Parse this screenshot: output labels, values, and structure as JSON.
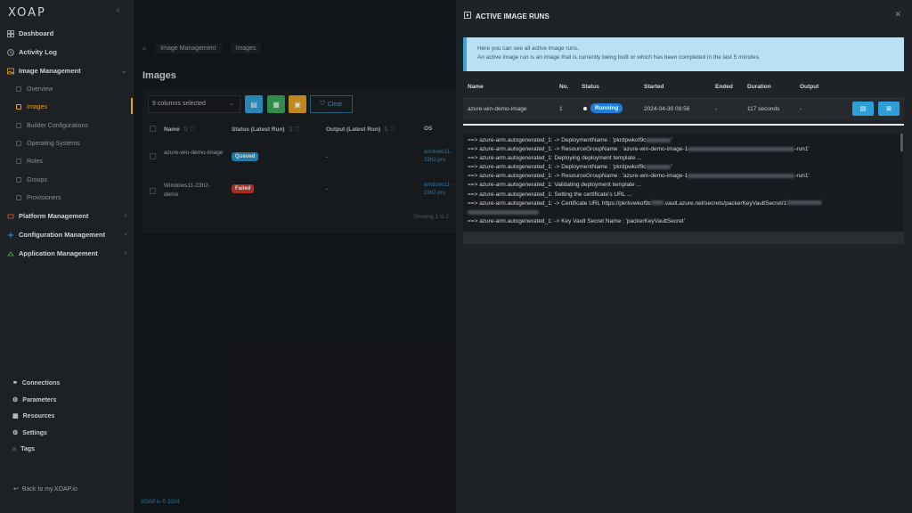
{
  "sidebar": {
    "logo": "XOAP",
    "collapse_icon": "chevron-left-icon",
    "items": [
      {
        "label": "Dashboard"
      },
      {
        "label": "Activity Log"
      },
      {
        "label": "Image Management"
      }
    ],
    "sub_items": [
      {
        "label": "Overview"
      },
      {
        "label": "Images"
      },
      {
        "label": "Builder Configurations"
      },
      {
        "label": "Operating Systems"
      },
      {
        "label": "Roles"
      },
      {
        "label": "Groups"
      },
      {
        "label": "Provisioners"
      }
    ],
    "groups": [
      {
        "label": "Platform Management"
      },
      {
        "label": "Configuration Management"
      },
      {
        "label": "Application Management"
      }
    ],
    "bottom": [
      {
        "label": "Connections"
      },
      {
        "label": "Parameters"
      },
      {
        "label": "Resources"
      },
      {
        "label": "Settings"
      },
      {
        "label": "Tags"
      }
    ],
    "back_link": "Back to my.XOAP.io"
  },
  "main": {
    "breadcrumb": [
      "Image Management",
      "Images"
    ],
    "title": "Images",
    "column_select": "9 columns selected",
    "clear_label": "Clear",
    "headers": {
      "name": "Name",
      "status": "Status (Latest Run)",
      "output": "Output (Latest Run)",
      "os": "OS"
    },
    "rows": [
      {
        "name": "azure-win-demo-image",
        "status": "Queued",
        "output": "-",
        "os": "windows11-23h2-pro"
      },
      {
        "name": "Windows11-23h2-demo",
        "status": "Failed",
        "output": "-",
        "os": "windows11-23h2-pro"
      }
    ],
    "paging": "Showing 1 to 2",
    "footer": "XOAP.io © 2024"
  },
  "panel": {
    "title": "ACTIVE IMAGE RUNS",
    "info_line1": "Here you can see all active image runs.",
    "info_line2": "An active image run is an image that is currently being built or which has been completed in the last 5 minutes.",
    "headers": {
      "name": "Name",
      "no": "No.",
      "status": "Status",
      "started": "Started",
      "ended": "Ended",
      "duration": "Duration",
      "output": "Output"
    },
    "run": {
      "name": "azure-win-demo-image",
      "no": "1",
      "status": "Running",
      "started": "2024-04-30 09:56",
      "ended": "-",
      "duration": "117 seconds",
      "output": "-"
    },
    "log": [
      {
        "a": "==> azure-arm.autogenerated_1:  -> DeploymentName    : 'pkrdpwkof9c",
        "b": "'"
      },
      {
        "a": "==> azure-arm.autogenerated_1:  -> ResourceGroupName : 'azure-win-demo-image-1",
        "b": "-run1'"
      },
      {
        "a": "==> azure-arm.autogenerated_1: Deploying deployment template ...",
        "b": ""
      },
      {
        "a": "==> azure-arm.autogenerated_1:  -> DeploymentName    : 'pkrdpwkof9c",
        "b": "'"
      },
      {
        "a": "==> azure-arm.autogenerated_1:  -> ResourceGroupName : 'azure-win-demo-image-1",
        "b": "-run1'"
      },
      {
        "a": "==> azure-arm.autogenerated_1: Validating deployment template ...",
        "b": ""
      },
      {
        "a": "==> azure-arm.autogenerated_1: Setting the certificate's URL ...",
        "b": ""
      },
      {
        "a": "==> azure-arm.autogenerated_1:  -> Certificate URL        https://pkrkvwkof9c",
        "b": ".vault.azure.net/secrets/packerKeyVaultSecret/1"
      },
      {
        "a": "",
        "b": ""
      },
      {
        "a": "==> azure-arm.autogenerated_1:  -> Key Vault Secret Name : 'packerKeyVaultSecret'",
        "b": ""
      }
    ]
  },
  "colors": {
    "accent": "#e0a020",
    "running": "#1f7fd8",
    "queued": "#2a8fbf",
    "failed": "#c0392b",
    "info_bg": "#b9e1f3"
  }
}
